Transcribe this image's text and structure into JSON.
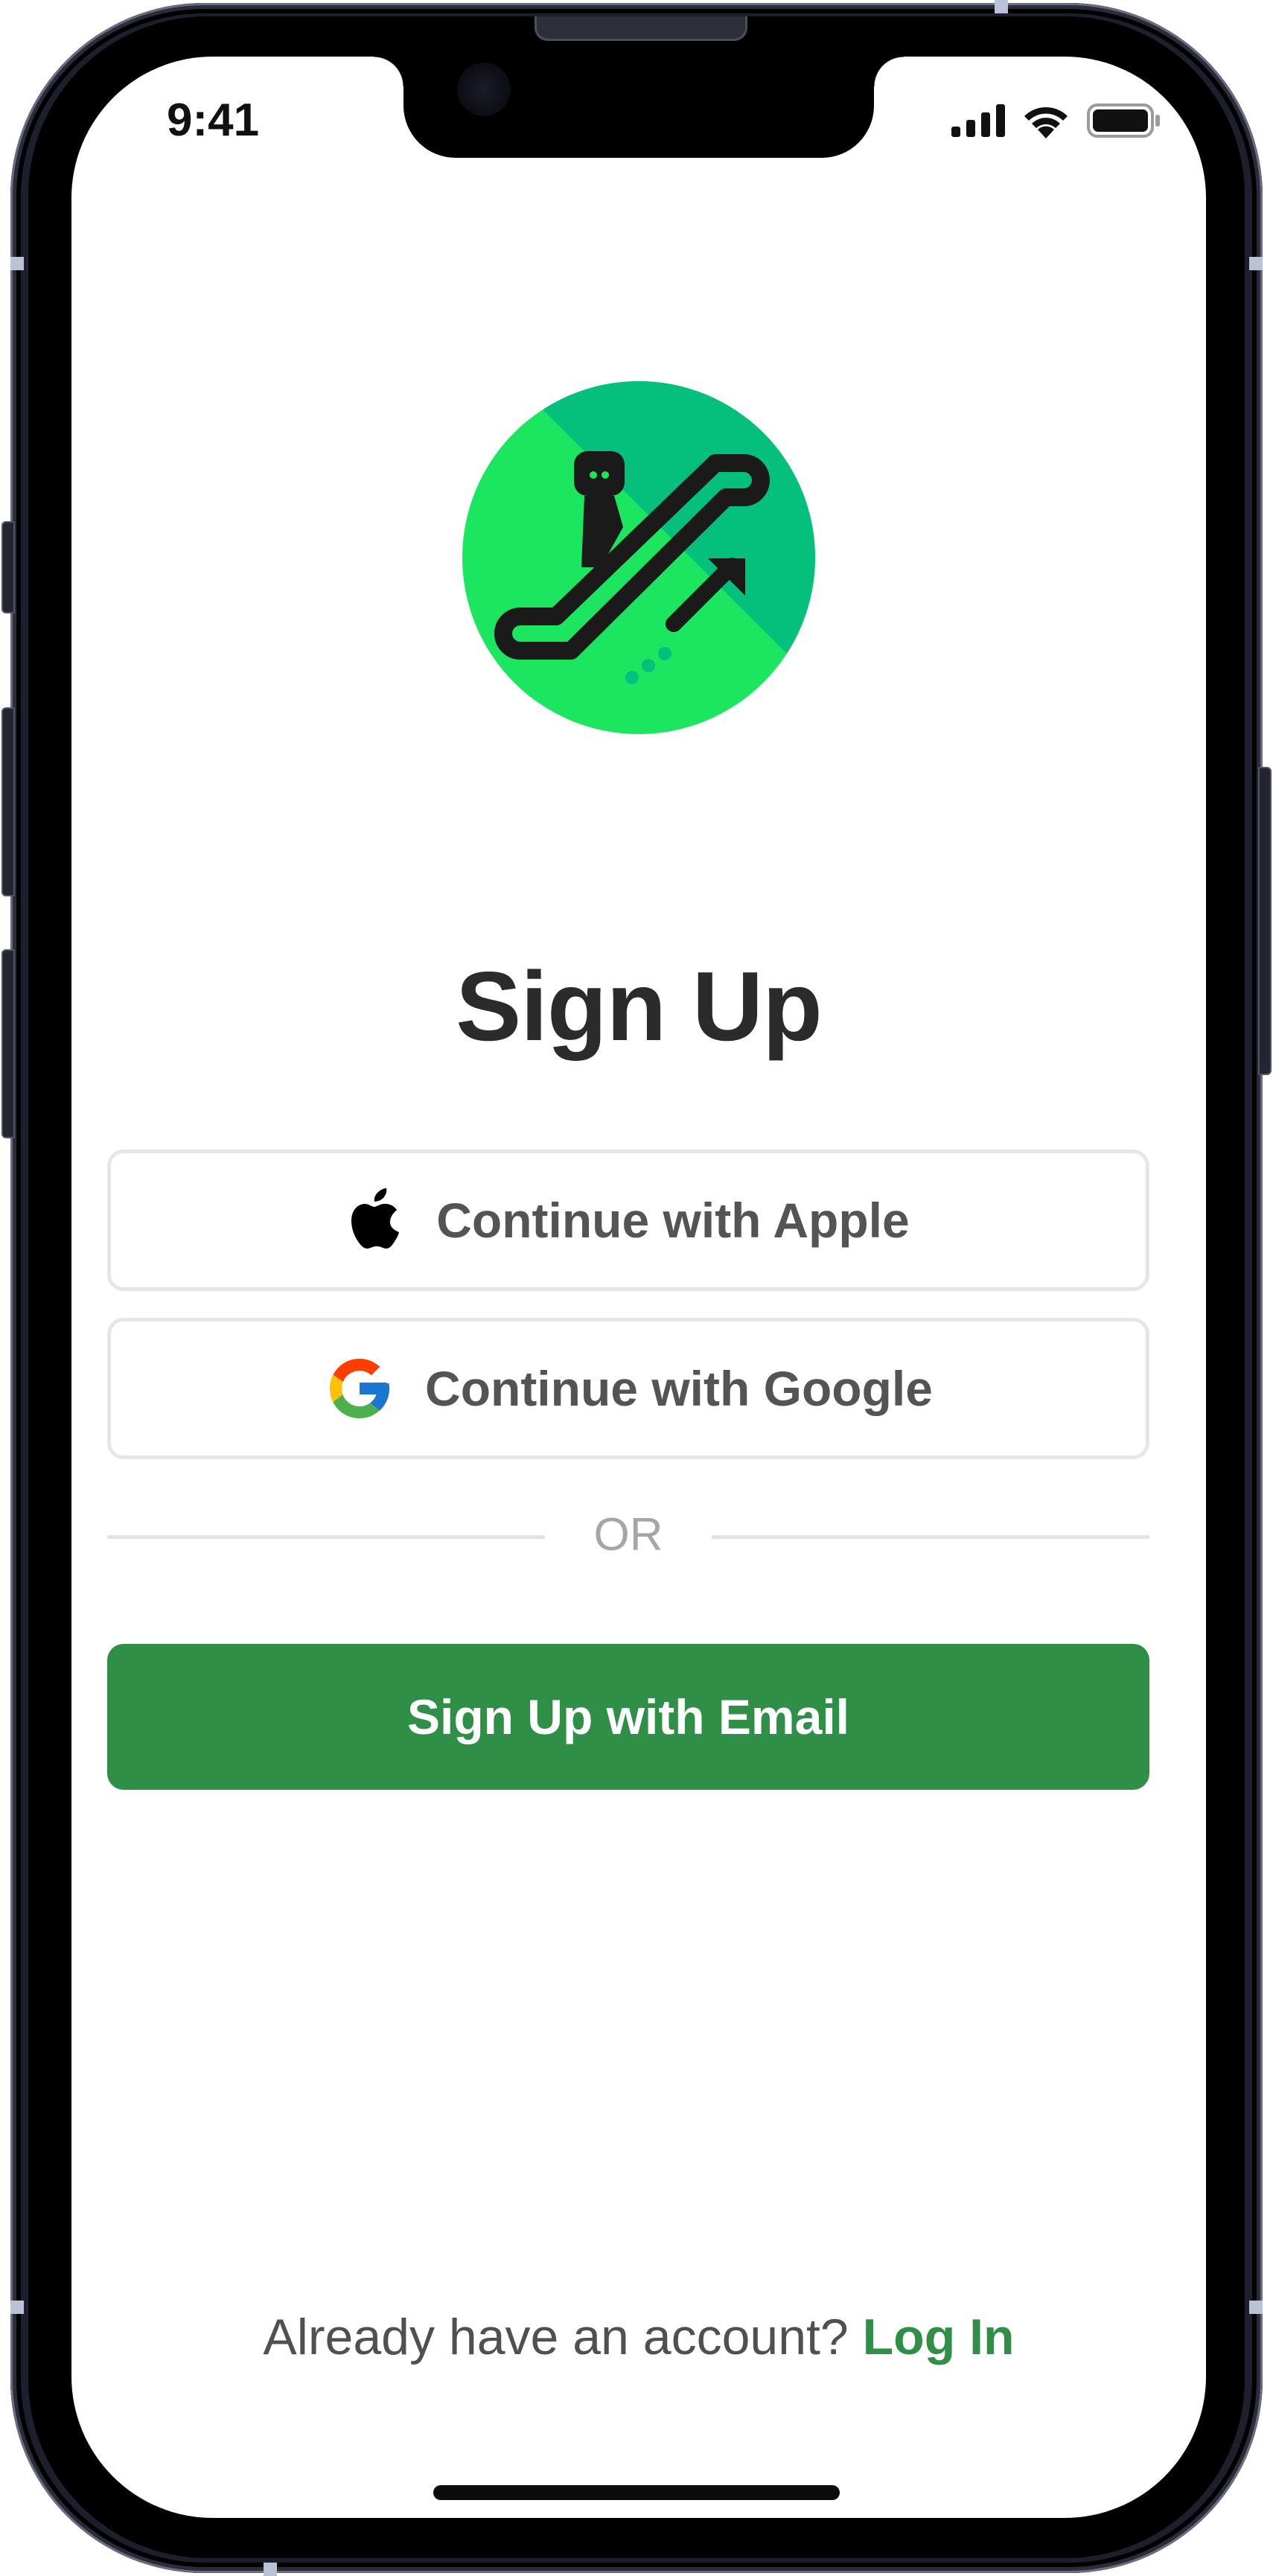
{
  "status_bar": {
    "time": "9:41",
    "icons": [
      "cellular-signal-icon",
      "wifi-icon",
      "battery-icon"
    ]
  },
  "logo": {
    "icon": "escalator-logo-icon",
    "colors": {
      "primary": "#1ce65f",
      "secondary": "#05c07c",
      "ink": "#1a1a1a"
    }
  },
  "title": "Sign Up",
  "buttons": {
    "apple": {
      "label": "Continue with Apple",
      "icon": "apple-icon"
    },
    "google": {
      "label": "Continue with Google",
      "icon": "google-icon"
    },
    "email": {
      "label": "Sign Up with Email"
    }
  },
  "divider": {
    "text": "OR"
  },
  "footer": {
    "prompt": "Already have an account?",
    "link": "Log In"
  },
  "colors": {
    "accent": "#2f8f46",
    "text": "#2b2b2b",
    "muted": "#a6a6a6",
    "border": "#e6e6e6"
  }
}
